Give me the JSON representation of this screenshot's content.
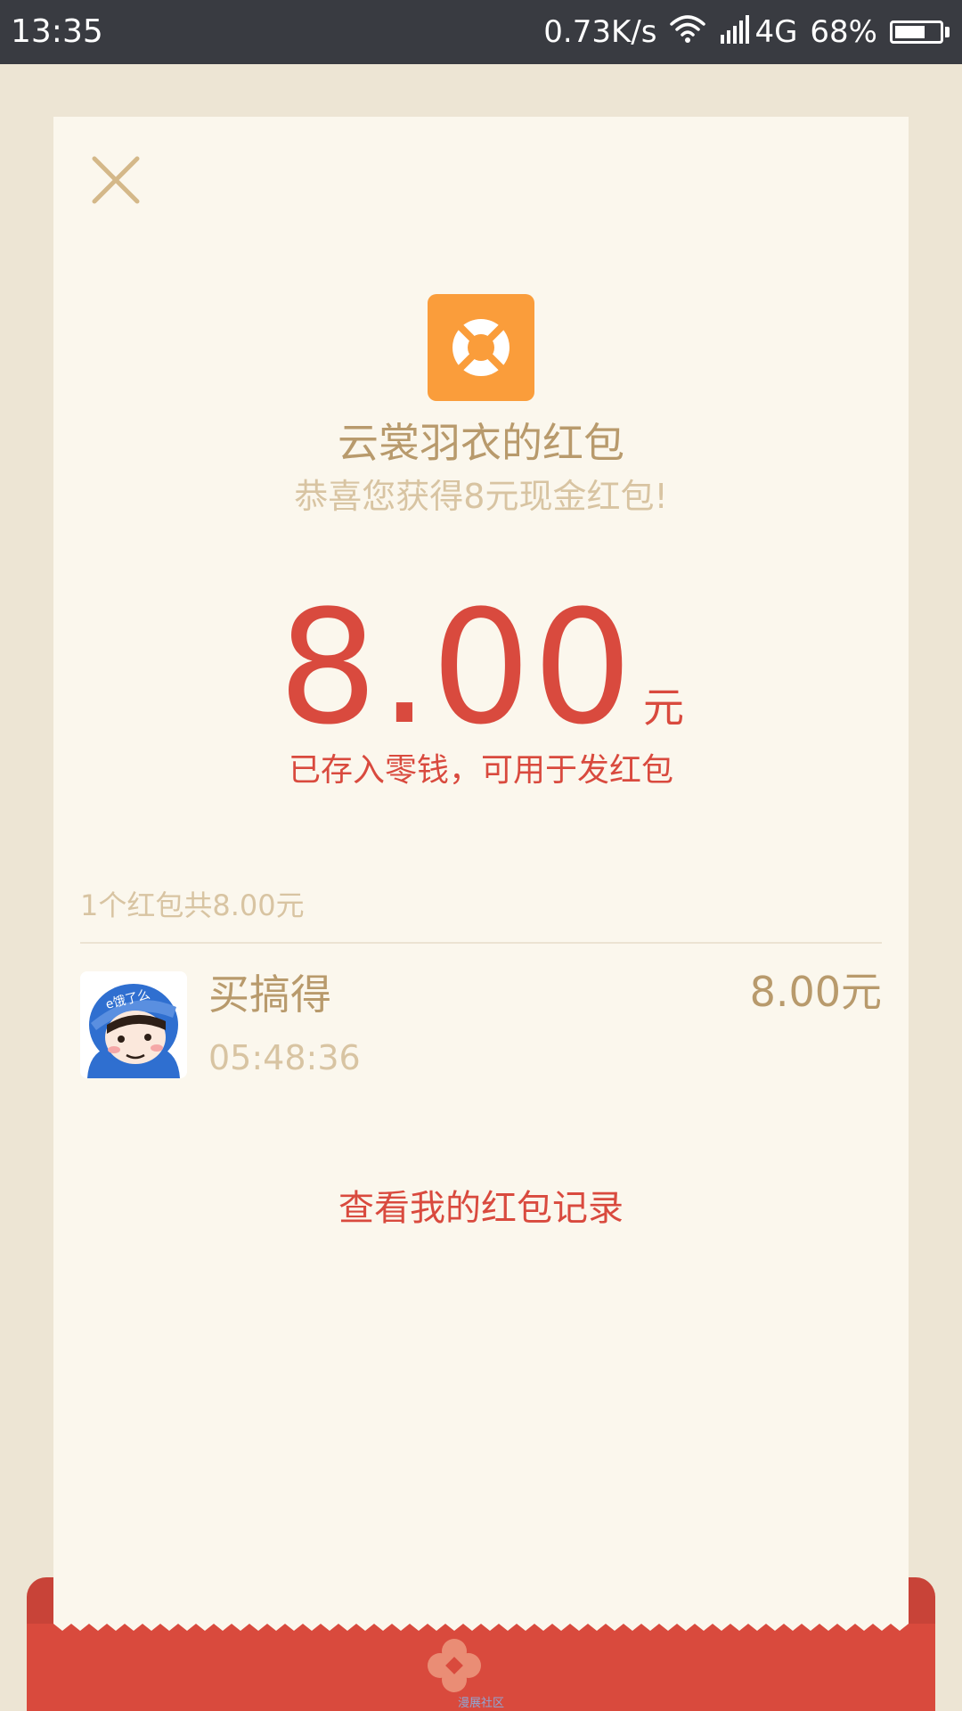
{
  "status_bar": {
    "time": "13:35",
    "network_speed": "0.73K/s",
    "network_type": "4G",
    "battery_percent": "68%",
    "battery_level": 0.68,
    "icons": [
      "wifi-icon",
      "signal-icon",
      "battery-icon"
    ]
  },
  "header": {
    "close_icon": "close-icon",
    "app_icon": "lifebuoy-logo-icon",
    "title": "云裳羽衣的红包",
    "subtitle": "恭喜您获得8元现金红包!"
  },
  "amount": {
    "value": "8.00",
    "unit": "元",
    "note": "已存入零钱，可用于发红包"
  },
  "summary": {
    "text": "1个红包共8.00元"
  },
  "recipients": [
    {
      "name": "买搞得",
      "time": "05:48:36",
      "amount": "8.00元",
      "avatar": "avatar-icon",
      "helmet_text": "e饿了么"
    }
  ],
  "footer": {
    "records_link": "查看我的红包记录",
    "envelope_logo_text": "漫展社区"
  },
  "colors": {
    "background": "#ede5d4",
    "card": "#fbf7ed",
    "accent_red": "#d94a3e",
    "gold_text": "#b89a6c",
    "light_gold_text": "#d8c4a2",
    "app_icon_orange": "#fa9d3b",
    "status_bar": "#393b41"
  }
}
